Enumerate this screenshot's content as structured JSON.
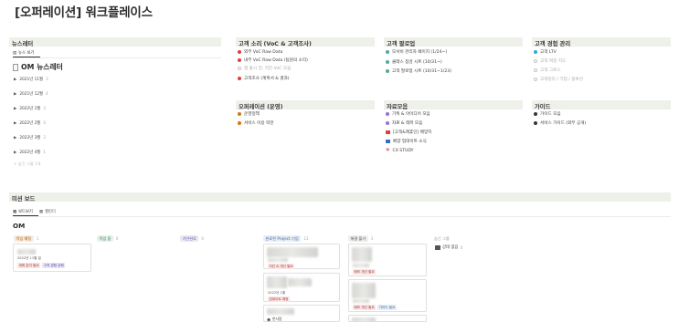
{
  "page": {
    "title": "[오퍼레이션] 워크플레이스"
  },
  "newsletter": {
    "header": "뉴스레터",
    "tab_label": "뉴스 보기",
    "title": "OM 뉴스레터",
    "groups": [
      {
        "label": "2021년 11월",
        "count": "3"
      },
      {
        "label": "2021년 12월",
        "count": "4"
      },
      {
        "label": "2022년 1월",
        "count": "3"
      },
      {
        "label": "2022년 2월",
        "count": "4"
      },
      {
        "label": "2022년 3월",
        "count": "3"
      },
      {
        "label": "2022년 4월",
        "count": "1"
      }
    ],
    "add_group": "+ 숨긴 그룹 1개"
  },
  "voc": {
    "header": "고객 소리 (VoC & 고객조사)",
    "items": [
      {
        "label": "외부 VoC Raw Data",
        "color": "#e03e3e"
      },
      {
        "label": "내부 VoC Raw Data (팀원의 소리)",
        "color": "#e03e3e"
      },
      {
        "label": "앱 출시 전, 지킨 VoC 모음",
        "color": "#cfcfcf",
        "muted": true
      },
      {
        "label": "고객조사 (계획서 & 결과)",
        "color": "#e03e3e"
      }
    ]
  },
  "operation": {
    "header": "오퍼레이션 (운영)",
    "items": [
      {
        "label": "운영정책",
        "color": "#d9730d"
      },
      {
        "label": "서비스 이용 약관",
        "color": "#d9730d"
      }
    ]
  },
  "followup": {
    "header": "고객 팔로업",
    "items": [
      {
        "label": "모서비 관리자 페이지 (1/24~)",
        "color": "#4dab9a"
      },
      {
        "label": "클래스 점검 시트 (10/31~)",
        "color": "#4dab9a"
      },
      {
        "label": "고객 팔로업 시트 (10/31~1/23)",
        "color": "#4dab9a"
      }
    ]
  },
  "resources": {
    "header": "자료모음",
    "items": [
      {
        "label": "기획 & 아이디어 모음",
        "color": "#9a6dd7",
        "kind": "dot"
      },
      {
        "label": "자료 & 레퍼 모음",
        "color": "#9a6dd7",
        "kind": "dot"
      },
      {
        "label": "[고객&제휴인] 배양지",
        "color": "#e03e3e",
        "kind": "flag"
      },
      {
        "label": "배양 업데이트 소식",
        "color": "#2f6fbf",
        "kind": "flag"
      },
      {
        "label": "CX STUDY",
        "color": "#e87c7c",
        "kind": "heart"
      }
    ]
  },
  "experience": {
    "header": "고객 경험 관리",
    "items": [
      {
        "label": "고객 LTV",
        "color": "#2eaadc"
      },
      {
        "label": "고객 여정 지도",
        "color": "#cfcfcf",
        "muted": true
      },
      {
        "label": "고객 그로스",
        "color": "#cfcfcf",
        "muted": true
      },
      {
        "label": "고객정리 / 기업 / 블루션",
        "color": "#cfcfcf",
        "muted": true
      }
    ]
  },
  "guide": {
    "header": "가이드",
    "items": [
      {
        "label": "가이드 모음",
        "color": "#37352f"
      },
      {
        "label": "서비스 가이드 (외부 공개)",
        "color": "#37352f"
      }
    ]
  },
  "board": {
    "header": "미션 보드",
    "tabs": [
      {
        "label": "보드보기",
        "active": true
      },
      {
        "label": "캘린더",
        "active": false
      }
    ],
    "title": "OM",
    "columns": [
      {
        "label": "작업 예정",
        "count": "1",
        "bg": "#faebdd",
        "fg": "#9a5b10"
      },
      {
        "label": "작업 중",
        "count": "0",
        "bg": "#e5f2ea",
        "fg": "#2f7a55"
      },
      {
        "label": "기안완료",
        "count": "0",
        "bg": "#ece7f5",
        "fg": "#6e5aa3"
      },
      {
        "label": "완료된 Project 기업",
        "count": "13",
        "bg": "#e7eef7",
        "fg": "#436a97"
      },
      {
        "label": "해결 불가",
        "count": "3",
        "bg": "#eeeeec",
        "fg": "#555"
      },
      {
        "label": "숨긴 그룹",
        "plain": true
      }
    ],
    "card1": {
      "date": "2022년 11월 일",
      "tags": [
        "계획 분석 필요",
        "고객 경험 강화"
      ]
    },
    "card_tag_a": "지킨 & 개선 필요",
    "card_tag_b": "업데이트 예정",
    "card_date_b": "2022년 1월",
    "card_tag_c": "배포 개선 필요",
    "card_tags_d": [
      "배포 개선 필요",
      "가이드 필요"
    ],
    "author": "한사람",
    "no_status": "상태 없음",
    "no_status_count": "0"
  }
}
